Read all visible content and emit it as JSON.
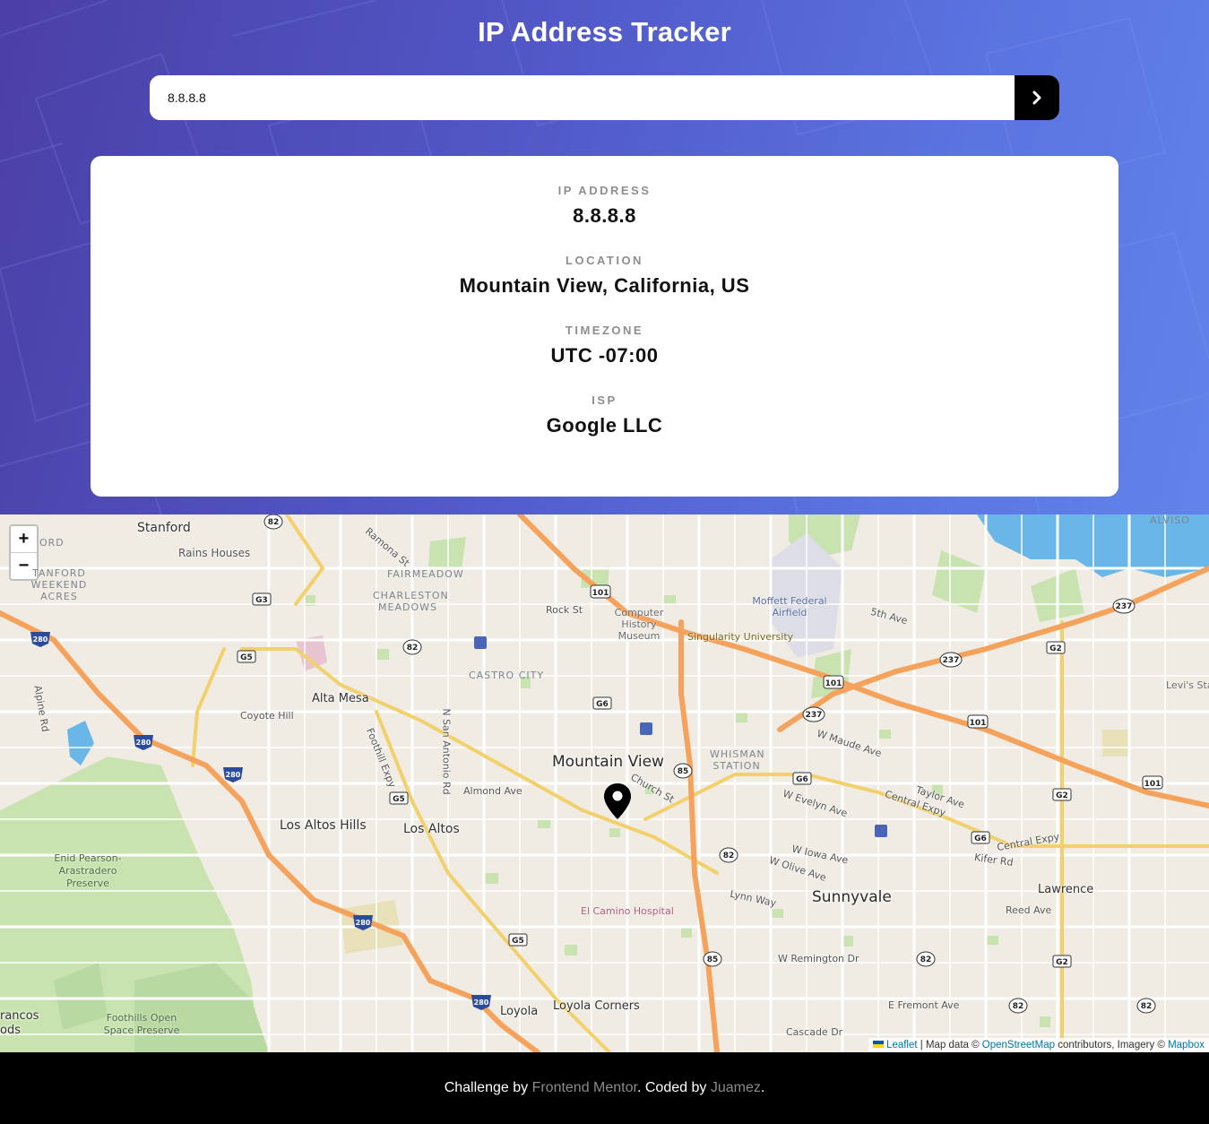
{
  "header": {
    "title": "IP Address Tracker",
    "search": {
      "value": "8.8.8.8",
      "placeholder": ""
    }
  },
  "stats": [
    {
      "label": "IP ADDRESS",
      "value": "8.8.8.8"
    },
    {
      "label": "LOCATION",
      "value": "Mountain View, California, US"
    },
    {
      "label": "TIMEZONE",
      "value": "UTC -07:00"
    },
    {
      "label": "ISP",
      "value": "Google LLC"
    }
  ],
  "map": {
    "zoom_in": "+",
    "zoom_out": "−",
    "marker_icon": "map-pin-icon",
    "labels": {
      "mountain_view": "Mountain View",
      "sunnyvale": "Sunnyvale",
      "los_altos": "Los Altos",
      "los_altos_hills": "Los Altos Hills",
      "stanford": "Stanford",
      "alta_mesa": "Alta Mesa",
      "lawrence": "Lawrence",
      "loyola": "Loyola",
      "loyola_corners": "Loyola Corners",
      "rains_houses": "Rains Houses",
      "coyote_hill": "Coyote Hill",
      "fairmeadow": "FAIRMEADOW",
      "charleston_meadows": "CHARLESTON MEADOWS",
      "castro_city": "CASTRO CITY",
      "whisman_station": "WHISMAN STATION",
      "stanford_weekend_acres": "TANFORD WEEKEND ACRES",
      "computer_history_museum": "Computer History Museum",
      "singularity_university": "Singularity University",
      "moffett": "Moffett Federal Airfield",
      "el_camino_hospital": "El Camino Hospital",
      "enid_pearson": "Enid Pearson-Arastradero Preserve",
      "foothills": "Foothills Open Space Preserve",
      "levis": "Levi's Sta",
      "alviso": "ALVISO",
      "rock_st": "Rock St",
      "almond_ave": "Almond Ave",
      "church_st": "Church St",
      "w_evelyn_ave": "W Evelyn Ave",
      "central_expy": "Central Expy",
      "w_maude_ave": "W Maude Ave",
      "w_iowa_ave": "W Iowa Ave",
      "w_olive_ave": "W Olive Ave",
      "lynn_way": "Lynn Way",
      "reed_ave": "Reed Ave",
      "kifer_rd": "Kifer Rd",
      "w_remington_dr": "W Remington Dr",
      "e_fremont_ave": "E Fremont Ave",
      "cascade_dr": "Cascade Dr",
      "taylor_ave": "Taylor Ave",
      "fifth_ave": "5th Ave",
      "foothill_expy": "Foothill Expy",
      "n_san_antonio_rd": "N San Antonio Rd",
      "ramona_st": "Ramona St",
      "alpine_rd": "Alpine Rd",
      "francos": "rancos",
      "ods": "ods",
      "ford": "ORD"
    },
    "shields": {
      "i280": "280",
      "us101": "101",
      "sr85": "85",
      "sr82": "82",
      "sr237": "237",
      "g3": "G3",
      "g5": "G5",
      "g6": "G6",
      "g2": "G2"
    },
    "attribution": {
      "leaflet": "Leaflet",
      "sep": "| Map data ©",
      "osm": "OpenStreetMap",
      "contrib": "contributors, Imagery ©",
      "mapbox": "Mapbox"
    }
  },
  "footer": {
    "prefix": "Challenge by",
    "frontend_mentor": "Frontend Mentor",
    "middle": ". Coded by",
    "author": "Juamez",
    "suffix": "."
  },
  "colors": {
    "header_gradient_start": "#4b3fa6",
    "header_gradient_end": "#6283ea",
    "search_button": "#000000",
    "label_gray": "#8e8e8e",
    "road_highway": "#f5a35c",
    "road_arterial": "#f2d06b",
    "park_green": "#c8e3b0",
    "water_blue": "#68b7e8"
  }
}
